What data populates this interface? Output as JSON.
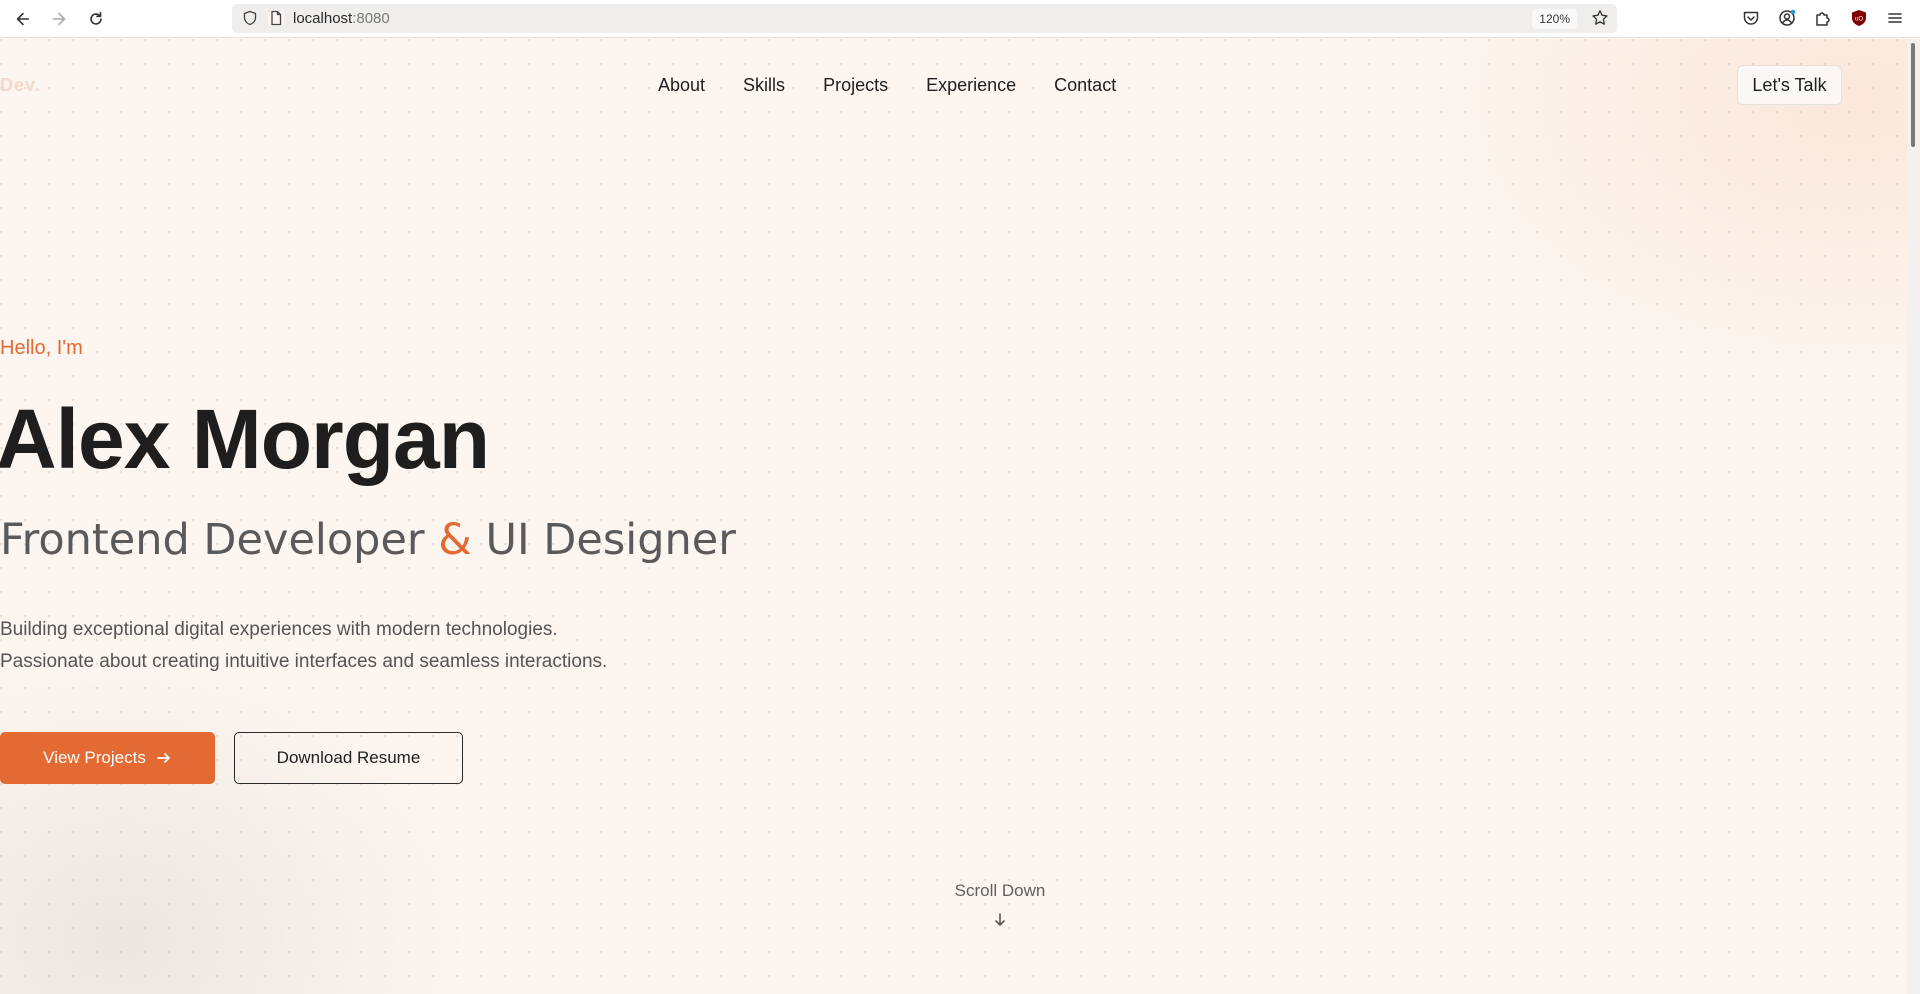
{
  "browser": {
    "url_host": "localhost",
    "url_port": ":8080",
    "zoom": "120%"
  },
  "site": {
    "logo": "Dev.",
    "nav": [
      {
        "label": "About"
      },
      {
        "label": "Skills"
      },
      {
        "label": "Projects"
      },
      {
        "label": "Experience"
      },
      {
        "label": "Contact"
      }
    ],
    "cta": "Let's Talk"
  },
  "hero": {
    "greeting": "Hello, I'm",
    "name": "Alex Morgan",
    "role_part1": "Frontend Developer ",
    "role_amp": "&",
    "role_part2": " UI Designer",
    "desc_line1": "Building exceptional digital experiences with modern technologies.",
    "desc_line2": "Passionate about creating intuitive interfaces and seamless interactions.",
    "primary_button": "View Projects",
    "secondary_button": "Download Resume",
    "scroll_label": "Scroll Down"
  },
  "colors": {
    "accent": "#e36a32",
    "heading": "#1e1e1e",
    "muted": "#555555"
  }
}
